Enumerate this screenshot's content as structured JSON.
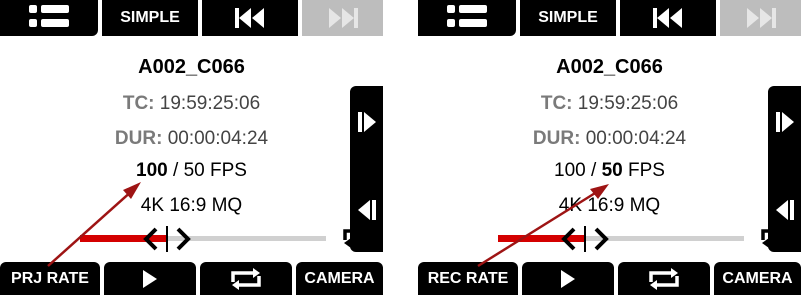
{
  "panels": [
    {
      "top": {
        "simple_label": "SIMPLE"
      },
      "clip_name": "A002_C066",
      "tc_label": "TC:",
      "tc_value": "19:59:25:06",
      "dur_label": "DUR:",
      "dur_value": "00:00:04:24",
      "fps_project": "100",
      "fps_sep": " / ",
      "fps_sensor": "50",
      "fps_unit": "FPS",
      "format": "4K 16:9 MQ",
      "playhead_progress": 0.35,
      "bottom": {
        "rate_label": "PRJ RATE",
        "camera_label": "CAMERA"
      }
    },
    {
      "top": {
        "simple_label": "SIMPLE"
      },
      "clip_name": "A002_C066",
      "tc_label": "TC:",
      "tc_value": "19:59:25:06",
      "dur_label": "DUR:",
      "dur_value": "00:00:04:24",
      "fps_project": "100",
      "fps_sep": " / ",
      "fps_sensor": "50",
      "fps_unit": "FPS",
      "format": "4K 16:9 MQ",
      "playhead_progress": 0.35,
      "bottom": {
        "rate_label": "REC RATE",
        "camera_label": "CAMERA"
      }
    }
  ],
  "icons": {
    "menu": "menu-icon",
    "skip_back": "skip-back-icon",
    "skip_forward": "skip-forward-icon",
    "step_forward": "step-forward-icon",
    "step_back": "step-back-icon",
    "play": "play-icon",
    "loop": "loop-icon"
  },
  "colors": {
    "accent_red": "#d40000",
    "annotation_arrow": "#9e1414",
    "disabled": "#bdbdbd"
  }
}
